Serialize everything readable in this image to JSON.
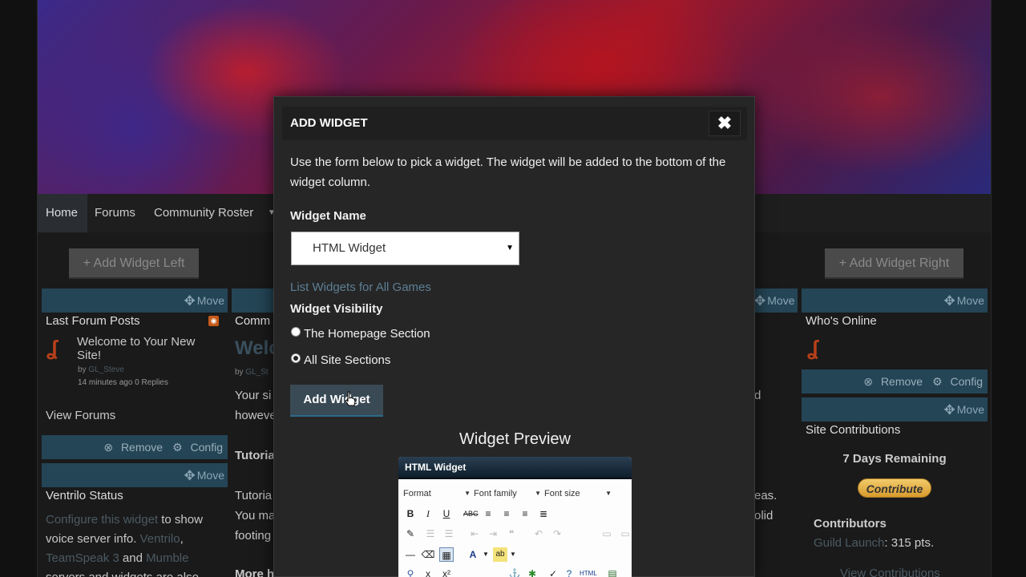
{
  "nav": {
    "items": [
      "Home",
      "Forums",
      "Community Roster"
    ]
  },
  "side_buttons": {
    "left": "+ Add Widget Left",
    "right": "+ Add Widget Right"
  },
  "widgets": {
    "move_label": "Move",
    "remove_label": "Remove",
    "config_label": "Config",
    "last_forum_posts": {
      "title": "Last Forum Posts",
      "post_title": "Welcome to Your New Site!",
      "by_prefix": "by",
      "author": "GL_Steve",
      "meta": "14 minutes ago 0 Replies",
      "view_link": "View Forums"
    },
    "ventrilo": {
      "title": "Ventrilo Status",
      "text_link1": "Configure this widget",
      "text_part1": " to show voice server info. ",
      "text_link2": "Ventrilo",
      "text_part2": ",",
      "text_link3": "TeamSpeak 3",
      "text_part3": " and ",
      "text_link4": "Mumble",
      "text_part4": "servers and widgets are also"
    },
    "center": {
      "tab": "Comm",
      "heading": "Welc",
      "by": "by",
      "line1": "Your si",
      "line2": "howeve",
      "tutorial": "Tutoria",
      "tutorial2": "Tutoria",
      "line3": "You ma",
      "line4": "footing",
      "more": "More h",
      "right_fragment1": "d",
      "right_fragment2": "eas.",
      "right_fragment3": "olid"
    },
    "whos_online": {
      "title": "Who's Online"
    },
    "site_contrib": {
      "title": "Site Contributions",
      "remaining": "7 Days Remaining",
      "button": "Contribute",
      "contributors_label": "Contributors",
      "contributor": "Guild Launch",
      "points": ": 315 pts.",
      "view_link": "View Contributions"
    }
  },
  "modal": {
    "title": "ADD WIDGET",
    "close": "✖",
    "description": "Use the form below to pick a widget. The widget will be added to the bottom of the widget column.",
    "widget_name_label": "Widget Name",
    "widget_name_value": "HTML Widget",
    "list_link": "List Widgets for All Games",
    "visibility_label": "Widget Visibility",
    "visibility_options": [
      "The Homepage Section",
      "All Site Sections"
    ],
    "visibility_selected": 1,
    "add_button": "Add Widget",
    "preview_title": "Widget Preview",
    "preview": {
      "header": "HTML Widget",
      "format": "Format",
      "font_family": "Font family",
      "font_size": "Font size"
    }
  }
}
